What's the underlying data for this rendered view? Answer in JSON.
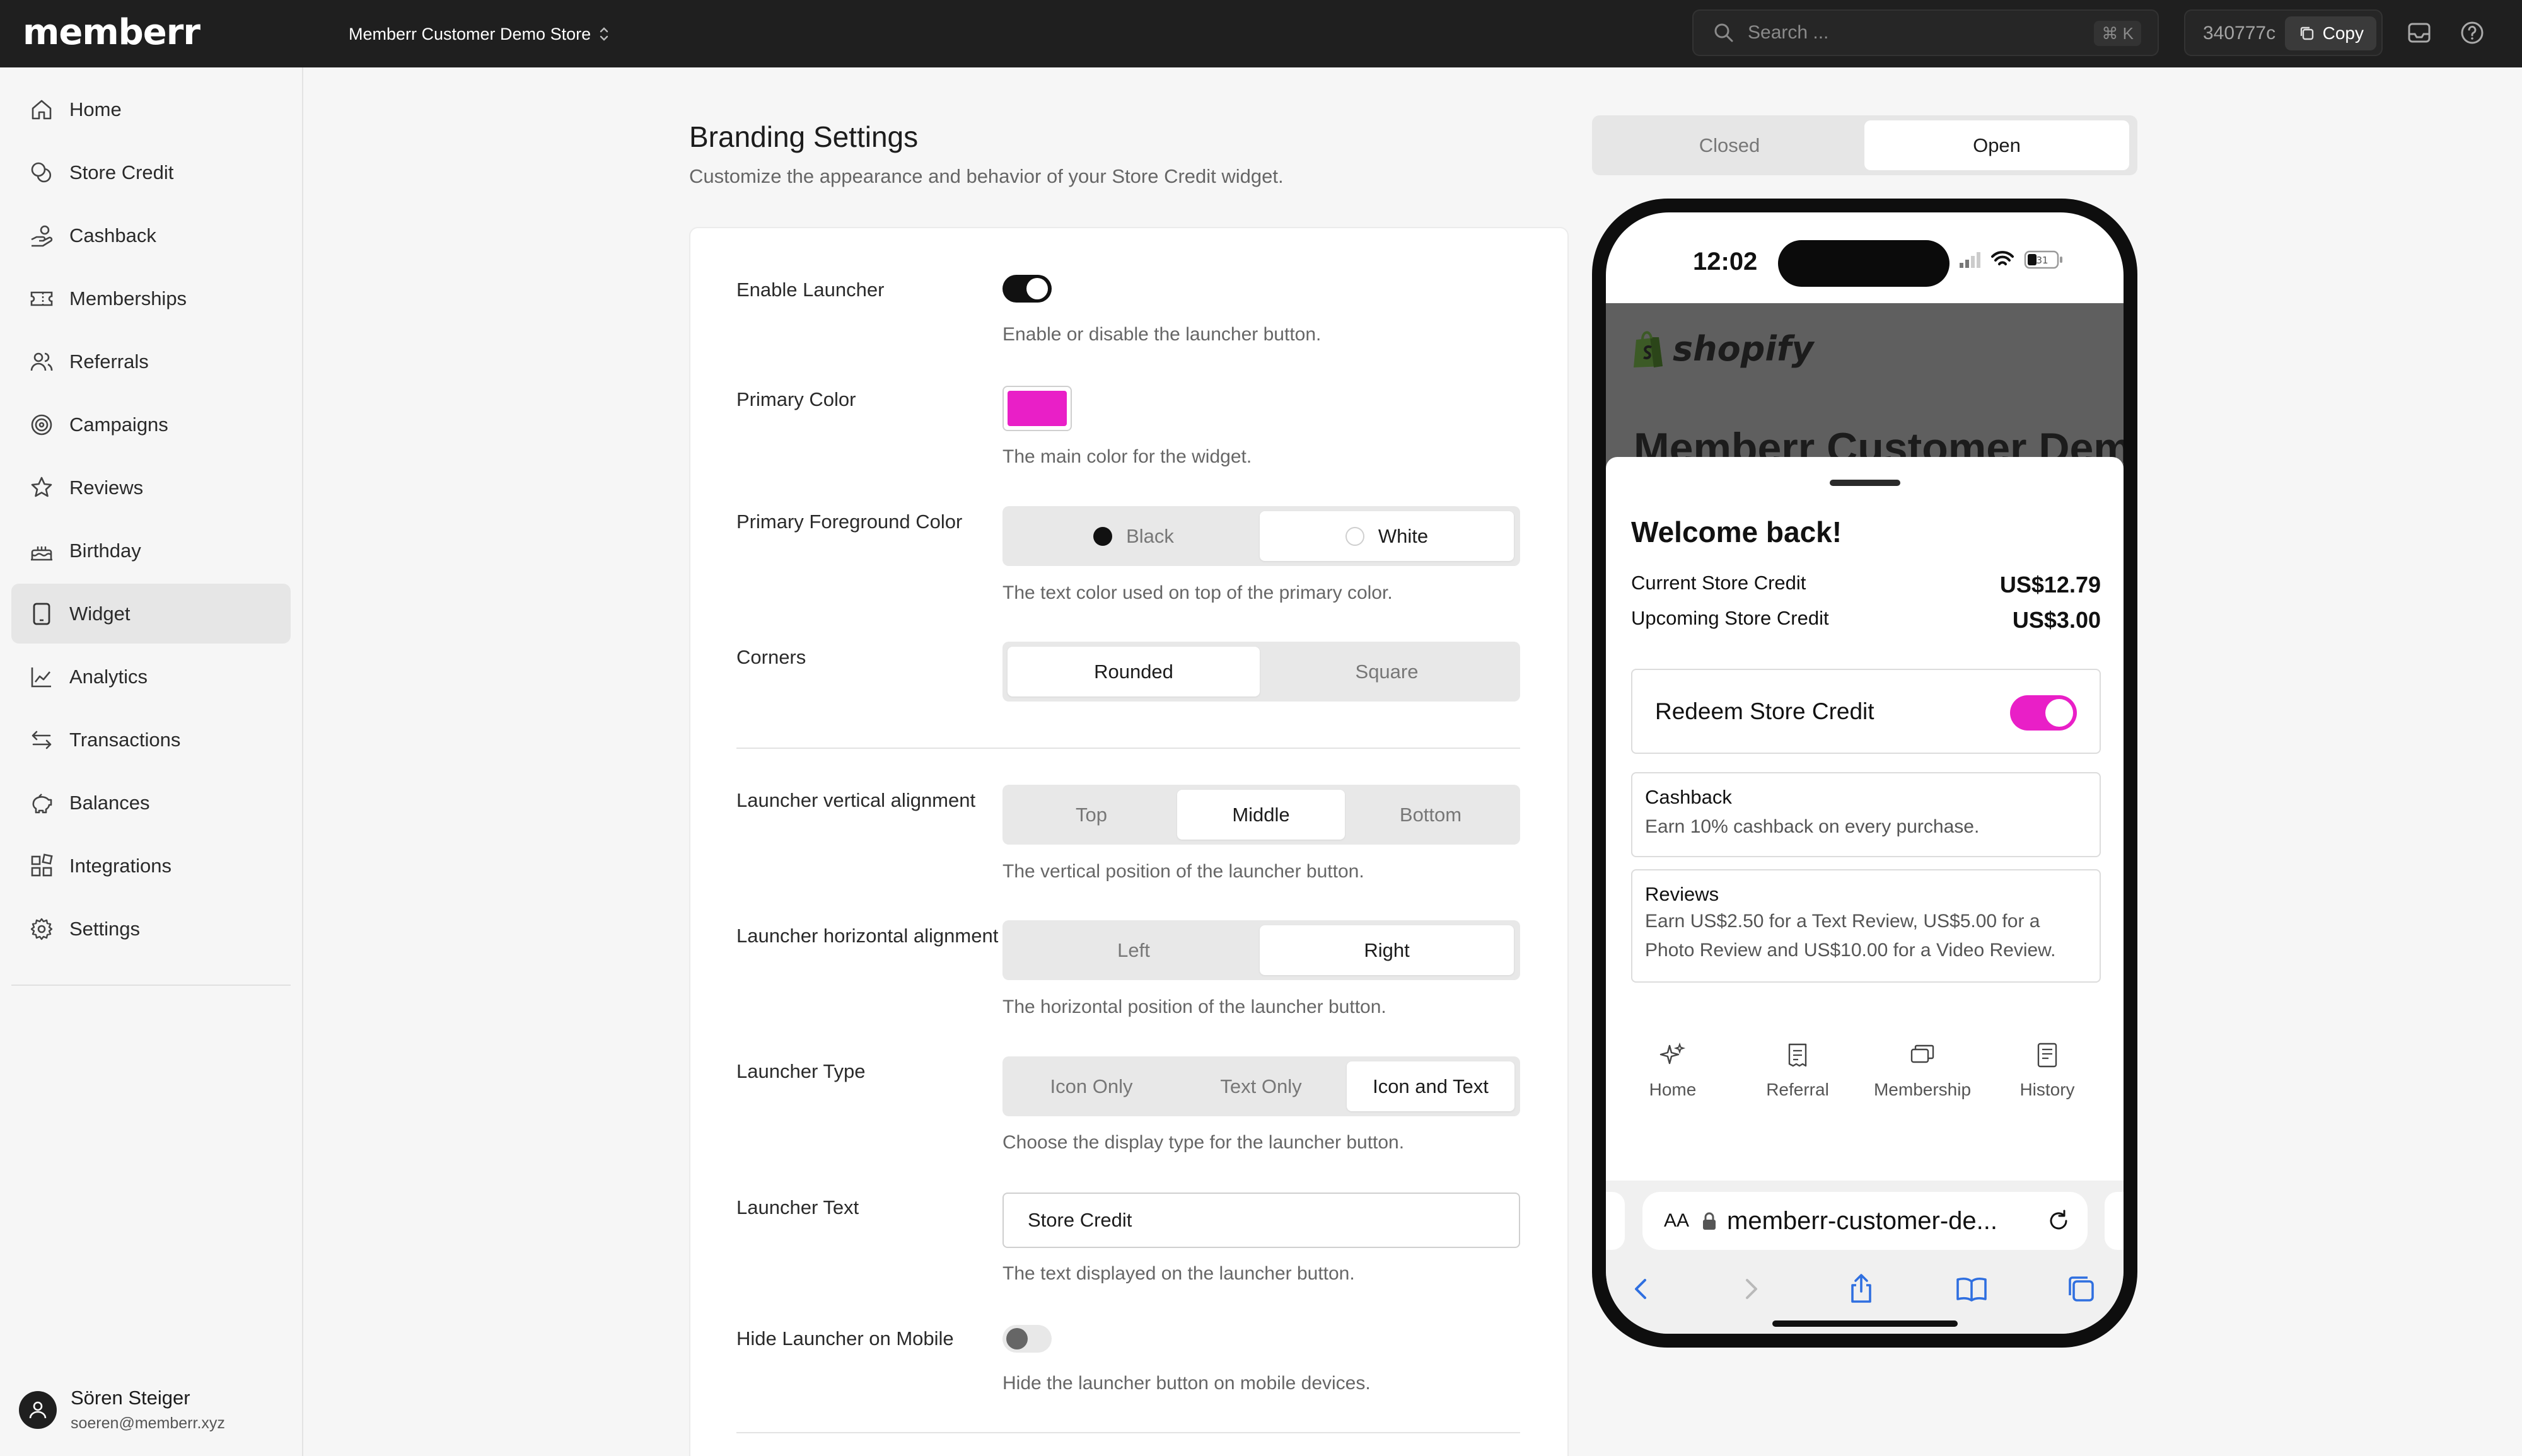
{
  "app": {
    "logo": "memberr",
    "store_name": "Memberr Customer Demo Store"
  },
  "search": {
    "placeholder": "Search ...",
    "shortcut": "⌘ K"
  },
  "api_id": {
    "value": "340777c",
    "copy_label": "Copy"
  },
  "sidebar": {
    "items": [
      {
        "label": "Home",
        "icon": "home-icon"
      },
      {
        "label": "Store Credit",
        "icon": "coins-icon"
      },
      {
        "label": "Cashback",
        "icon": "hand-coins-icon"
      },
      {
        "label": "Memberships",
        "icon": "ticket-icon"
      },
      {
        "label": "Referrals",
        "icon": "users-icon"
      },
      {
        "label": "Campaigns",
        "icon": "target-icon"
      },
      {
        "label": "Reviews",
        "icon": "star-icon"
      },
      {
        "label": "Birthday",
        "icon": "cake-icon"
      },
      {
        "label": "Widget",
        "icon": "tablet-icon",
        "active": true
      },
      {
        "label": "Analytics",
        "icon": "chart-icon"
      },
      {
        "label": "Transactions",
        "icon": "arrows-icon"
      },
      {
        "label": "Balances",
        "icon": "piggy-bank-icon"
      },
      {
        "label": "Integrations",
        "icon": "blocks-icon"
      },
      {
        "label": "Settings",
        "icon": "gear-icon"
      }
    ],
    "user": {
      "name": "Sören Steiger",
      "email": "soeren@memberr.xyz"
    }
  },
  "page": {
    "title": "Branding Settings",
    "subtitle": "Customize the appearance and behavior of your Store Credit widget."
  },
  "form": {
    "enable_launcher": {
      "label": "Enable Launcher",
      "help": "Enable or disable the launcher button.",
      "on": true
    },
    "primary_color": {
      "label": "Primary Color",
      "help": "The main color for the widget.",
      "value": "#e91fc7"
    },
    "primary_fg": {
      "label": "Primary Foreground Color",
      "options": [
        "Black",
        "White"
      ],
      "selected": "White",
      "help": "The text color used on top of the primary color."
    },
    "corners": {
      "label": "Corners",
      "options": [
        "Rounded",
        "Square"
      ],
      "selected": "Rounded"
    },
    "vertical": {
      "label": "Launcher vertical alignment",
      "options": [
        "Top",
        "Middle",
        "Bottom"
      ],
      "selected": "Middle",
      "help": "The vertical position of the launcher button."
    },
    "horizontal": {
      "label": "Launcher horizontal alignment",
      "options": [
        "Left",
        "Right"
      ],
      "selected": "Right",
      "help": "The horizontal position of the launcher button."
    },
    "launcher_type": {
      "label": "Launcher Type",
      "options": [
        "Icon Only",
        "Text Only",
        "Icon and Text"
      ],
      "selected": "Icon and Text",
      "help": "Choose the display type for the launcher button."
    },
    "launcher_text": {
      "label": "Launcher Text",
      "value": "Store Credit",
      "help": "The text displayed on the launcher button."
    },
    "hide_mobile": {
      "label": "Hide Launcher on Mobile",
      "help": "Hide the launcher button on mobile devices.",
      "on": false
    }
  },
  "preview": {
    "tabs": [
      "Closed",
      "Open"
    ],
    "selected_tab": "Open",
    "time": "12:02",
    "battery": "31",
    "shop_logo": "shopify",
    "shop_title": "Memberr Customer Demo Store",
    "welcome": "Welcome back!",
    "current_label": "Current Store Credit",
    "current_value": "US$12.79",
    "upcoming_label": "Upcoming Store Credit",
    "upcoming_value": "US$3.00",
    "redeem_label": "Redeem Store Credit",
    "redeem_on": true,
    "cards": [
      {
        "title": "Cashback",
        "desc": "Earn 10% cashback on every purchase."
      },
      {
        "title": "Reviews",
        "desc": "Earn US$2.50 for a Text Review, US$5.00 for a Photo Review and US$10.00 for a Video Review."
      }
    ],
    "nav": [
      {
        "label": "Home",
        "icon": "sparkle-icon"
      },
      {
        "label": "Referral",
        "icon": "receipt-icon"
      },
      {
        "label": "Membership",
        "icon": "cards-icon"
      },
      {
        "label": "History",
        "icon": "list-doc-icon"
      }
    ],
    "url_aa": "AA",
    "url": "memberr-customer-de..."
  },
  "colors": {
    "accent": "#e91fc7",
    "topbar": "#1f1f1f",
    "toggle_dark": "#111111"
  }
}
